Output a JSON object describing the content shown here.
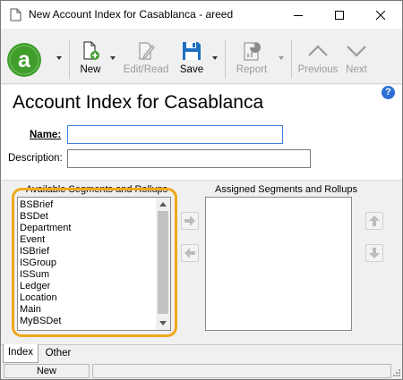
{
  "window": {
    "title": "New Account Index for Casablanca - areed",
    "controls": [
      "minimize",
      "maximize",
      "close"
    ]
  },
  "toolbar": {
    "new_label": "New",
    "edit_read_label": "Edit/Read",
    "save_label": "Save",
    "report_label": "Report",
    "previous_label": "Previous",
    "next_label": "Next"
  },
  "form": {
    "page_title": "Account Index for Casablanca",
    "name_label": "Name:",
    "name_value": "",
    "description_label": "Description:",
    "description_value": ""
  },
  "segments": {
    "available_label": "Available Segments and Rollups",
    "assigned_label": "Assigned Segments and Rollups",
    "available_items": [
      "BSBrief",
      "BSDet",
      "Department",
      "Event",
      "ISBrief",
      "ISGroup",
      "ISSum",
      "Ledger",
      "Location",
      "Main",
      "MyBSDet"
    ],
    "assigned_items": []
  },
  "tabs": [
    {
      "label": "Index",
      "active": true
    },
    {
      "label": "Other",
      "active": false
    }
  ],
  "status": {
    "mode": "New"
  },
  "colors": {
    "accent_logo": "#3f9e2c",
    "highlight": "#f0a81c",
    "save_icon": "#1f6fc1",
    "focus_border": "#3a7fd5"
  }
}
